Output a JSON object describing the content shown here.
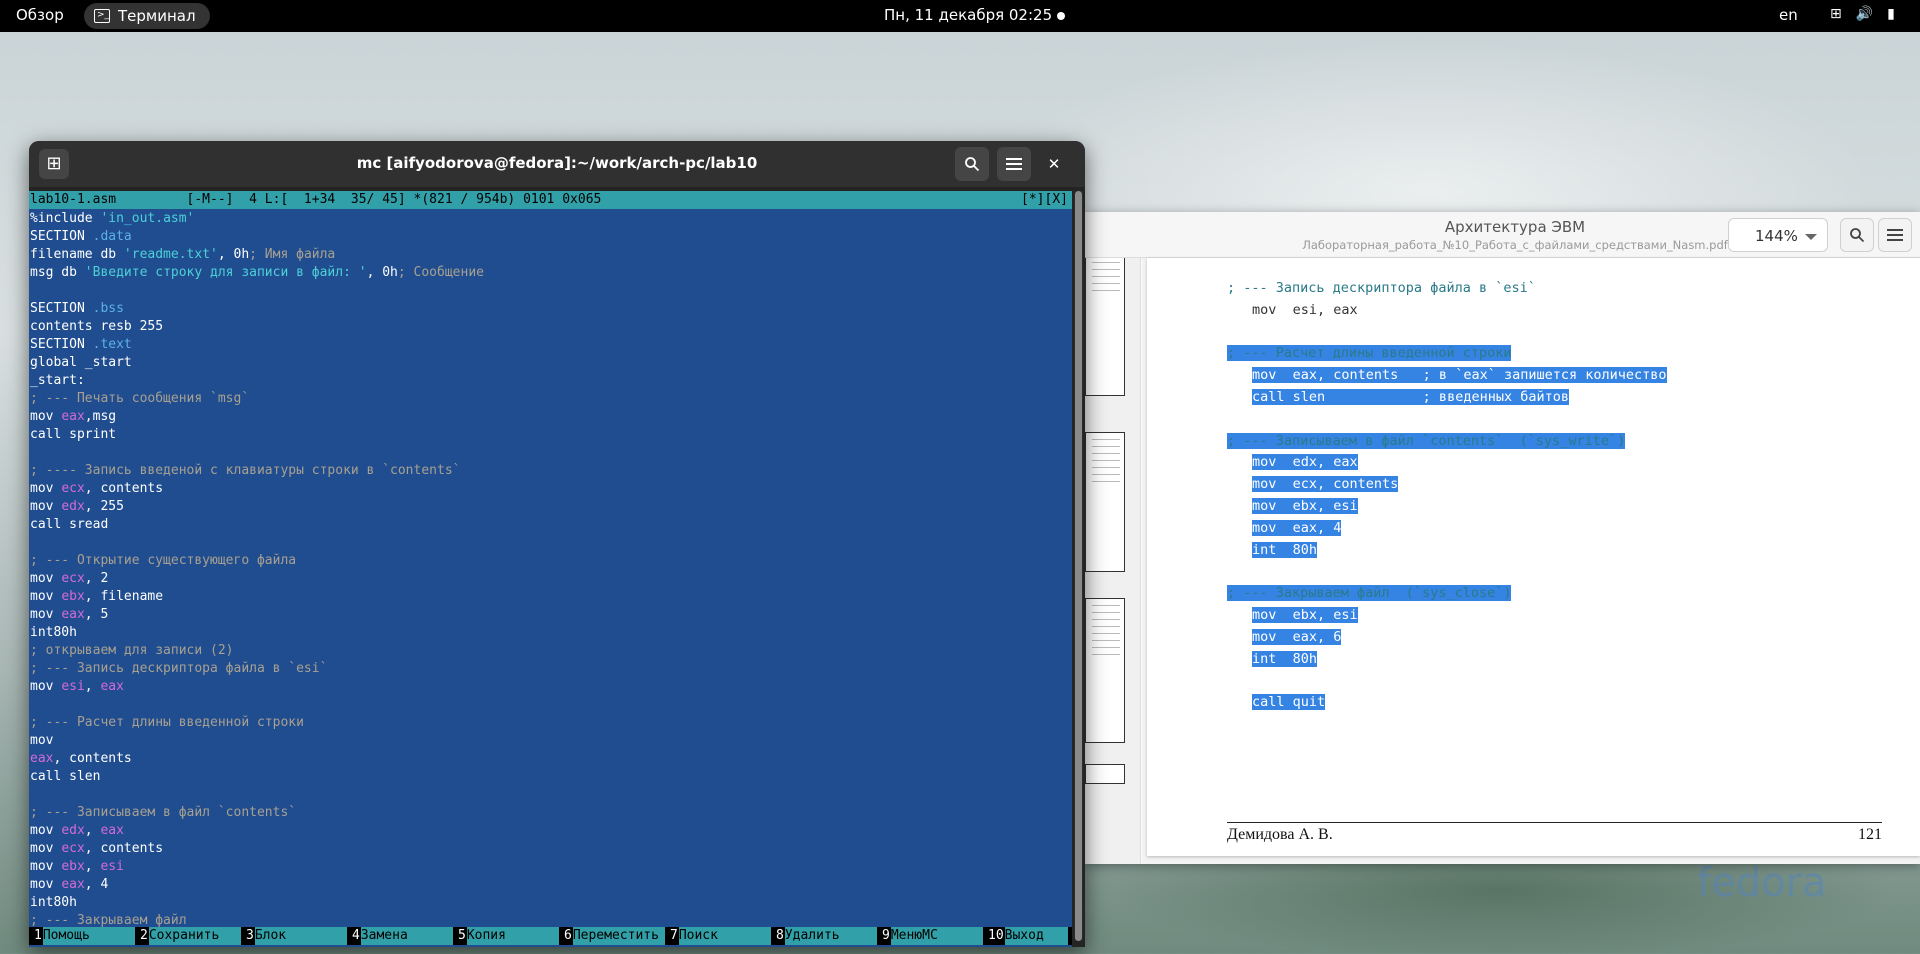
{
  "topbar": {
    "overview": "Обзор",
    "app_name": "Терминал",
    "clock": "Пн, 11 декабря  02:25",
    "lang": "en"
  },
  "pdf": {
    "title": "Архитектура ЭВМ",
    "subtitle": "Лабораторная_работа_№10_Работа_с_файлами_средствами_Nasm.pdf",
    "zoom": "144%",
    "lines": [
      {
        "text": "; --- Запись дескриптора файла в `esi`",
        "hl": false,
        "indent": 0
      },
      {
        "text": "mov  esi, eax",
        "hl": false,
        "indent": 1
      },
      {
        "text": "",
        "hl": false,
        "indent": 0
      },
      {
        "text": "; --- Расчет длины введенной строки",
        "hl": true,
        "indent": 0
      },
      {
        "text": "mov  eax, contents   ; в `eax` запишется количество",
        "hl": true,
        "indent": 1
      },
      {
        "text": "call slen            ; введенных байтов",
        "hl": true,
        "indent": 1
      },
      {
        "text": "",
        "hl": false,
        "indent": 0
      },
      {
        "text": "; --- Записываем в файл `contents`  (`sys_write`)",
        "hl": true,
        "indent": 0
      },
      {
        "text": "mov  edx, eax",
        "hl": true,
        "indent": 1
      },
      {
        "text": "mov  ecx, contents",
        "hl": true,
        "indent": 1
      },
      {
        "text": "mov  ebx, esi",
        "hl": true,
        "indent": 1
      },
      {
        "text": "mov  eax, 4",
        "hl": true,
        "indent": 1
      },
      {
        "text": "int  80h",
        "hl": true,
        "indent": 1
      },
      {
        "text": "",
        "hl": false,
        "indent": 0
      },
      {
        "text": "; --- Закрываем файл  (`sys_close`)",
        "hl": true,
        "indent": 0
      },
      {
        "text": "mov  ebx, esi",
        "hl": true,
        "indent": 1
      },
      {
        "text": "mov  eax, 6",
        "hl": true,
        "indent": 1
      },
      {
        "text": "int  80h",
        "hl": true,
        "indent": 1
      },
      {
        "text": "",
        "hl": false,
        "indent": 0
      },
      {
        "text": "call quit",
        "hl": true,
        "indent": 1
      }
    ],
    "footer_author": "Демидова А. В.",
    "footer_page": "121"
  },
  "terminal": {
    "title": "mc [aifyodorova@fedora]:~/work/arch-pc/lab10",
    "status_left": "lab10-1.asm         [-M--]  4 L:[  1+34  35/ 45] *(821 / 954b) 0101 0x065",
    "status_right": "[*][X]",
    "code": [
      [
        {
          "t": "%include ",
          "c": ""
        },
        {
          "t": "'in_out.asm'",
          "c": "str"
        }
      ],
      [
        {
          "t": "SECTION ",
          "c": ""
        },
        {
          "t": ".data",
          "c": "sec"
        }
      ],
      [
        {
          "t": "filename db ",
          "c": ""
        },
        {
          "t": "'readme.txt'",
          "c": "str"
        },
        {
          "t": ", 0h",
          "c": ""
        },
        {
          "t": "; Имя файла",
          "c": "cmt"
        }
      ],
      [
        {
          "t": "msg db ",
          "c": ""
        },
        {
          "t": "'Введите строку для записи в файл: '",
          "c": "str"
        },
        {
          "t": ", 0h",
          "c": ""
        },
        {
          "t": "; Сообщение",
          "c": "cmt"
        }
      ],
      [],
      [
        {
          "t": "SECTION ",
          "c": ""
        },
        {
          "t": ".bss",
          "c": "sec"
        }
      ],
      [
        {
          "t": "contents resb 255",
          "c": ""
        }
      ],
      [
        {
          "t": "SECTION ",
          "c": ""
        },
        {
          "t": ".text",
          "c": "sec"
        }
      ],
      [
        {
          "t": "global _start",
          "c": ""
        }
      ],
      [
        {
          "t": "_start:",
          "c": ""
        }
      ],
      [
        {
          "t": "; --- Печать сообщения `msg`",
          "c": "cmt"
        }
      ],
      [
        {
          "t": "mov ",
          "c": ""
        },
        {
          "t": "eax",
          "c": "reg"
        },
        {
          "t": ",msg",
          "c": ""
        }
      ],
      [
        {
          "t": "call sprint",
          "c": ""
        }
      ],
      [],
      [
        {
          "t": "; ---- Запись введеной с клавиатуры строки в `contents`",
          "c": "cmt"
        }
      ],
      [
        {
          "t": "mov ",
          "c": ""
        },
        {
          "t": "ecx",
          "c": "reg"
        },
        {
          "t": ", contents",
          "c": ""
        }
      ],
      [
        {
          "t": "mov ",
          "c": ""
        },
        {
          "t": "edx",
          "c": "reg"
        },
        {
          "t": ", 255",
          "c": ""
        }
      ],
      [
        {
          "t": "call sread",
          "c": ""
        }
      ],
      [],
      [
        {
          "t": "; --- Открытие существующего файла",
          "c": "cmt"
        }
      ],
      [
        {
          "t": "mov ",
          "c": ""
        },
        {
          "t": "ecx",
          "c": "reg"
        },
        {
          "t": ", 2",
          "c": ""
        }
      ],
      [
        {
          "t": "mov ",
          "c": ""
        },
        {
          "t": "ebx",
          "c": "reg"
        },
        {
          "t": ", filename",
          "c": ""
        }
      ],
      [
        {
          "t": "mov ",
          "c": ""
        },
        {
          "t": "eax",
          "c": "reg"
        },
        {
          "t": ", 5",
          "c": ""
        }
      ],
      [
        {
          "t": "int80h",
          "c": ""
        }
      ],
      [
        {
          "t": "; открываем для записи (2)",
          "c": "cmt"
        }
      ],
      [
        {
          "t": "; --- Запись дескриптора файла в `esi`",
          "c": "cmt"
        }
      ],
      [
        {
          "t": "mov ",
          "c": ""
        },
        {
          "t": "esi",
          "c": "reg"
        },
        {
          "t": ", ",
          "c": ""
        },
        {
          "t": "eax",
          "c": "reg"
        }
      ],
      [],
      [
        {
          "t": "; --- Расчет длины введенной строки",
          "c": "cmt"
        }
      ],
      [
        {
          "t": "mov",
          "c": ""
        }
      ],
      [
        {
          "t": "eax",
          "c": "reg"
        },
        {
          "t": ", contents",
          "c": ""
        }
      ],
      [
        {
          "t": "call slen",
          "c": ""
        }
      ],
      [],
      [
        {
          "t": "; --- Записываем в файл `contents`",
          "c": "cmt"
        }
      ],
      [
        {
          "t": "mov ",
          "c": ""
        },
        {
          "t": "edx",
          "c": "reg"
        },
        {
          "t": ", ",
          "c": ""
        },
        {
          "t": "eax",
          "c": "reg"
        }
      ],
      [
        {
          "t": "mov ",
          "c": ""
        },
        {
          "t": "ecx",
          "c": "reg"
        },
        {
          "t": ", contents",
          "c": ""
        }
      ],
      [
        {
          "t": "mov ",
          "c": ""
        },
        {
          "t": "ebx",
          "c": "reg"
        },
        {
          "t": ", ",
          "c": ""
        },
        {
          "t": "esi",
          "c": "reg"
        }
      ],
      [
        {
          "t": "mov ",
          "c": ""
        },
        {
          "t": "eax",
          "c": "reg"
        },
        {
          "t": ", 4",
          "c": ""
        }
      ],
      [
        {
          "t": "int80h",
          "c": ""
        }
      ],
      [
        {
          "t": "; --- Закрываем файл",
          "c": "cmt"
        }
      ]
    ],
    "fkeys": [
      {
        "n": "1",
        "label": "Помощь",
        "w": 10
      },
      {
        "n": "2",
        "label": "Сохранить",
        "w": 10
      },
      {
        "n": "3",
        "label": "Блок",
        "w": 10
      },
      {
        "n": "4",
        "label": "Замена",
        "w": 10
      },
      {
        "n": "5",
        "label": "Копия",
        "w": 10
      },
      {
        "n": "6",
        "label": "Переместить",
        "w": 10
      },
      {
        "n": "7",
        "label": "Поиск",
        "w": 10
      },
      {
        "n": "8",
        "label": "Удалить",
        "w": 10
      },
      {
        "n": "9",
        "label": "МенюMC",
        "w": 10
      },
      {
        "n": "10",
        "label": "Выход",
        "w": 10
      }
    ]
  },
  "watermark": "fedora",
  "colors": {
    "mc_bg": "#1f4d8f",
    "mc_bar": "#32a0a8",
    "selection": "#3584e4"
  }
}
